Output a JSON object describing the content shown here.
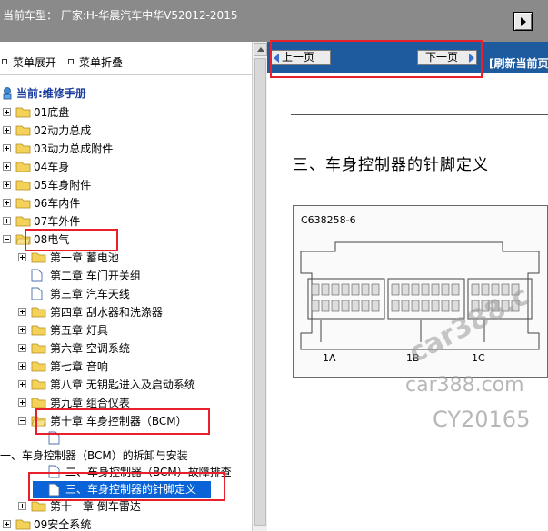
{
  "header": {
    "title": "当前车型： 厂家:H-华晨汽车中华V52012-2015"
  },
  "menu_tools": {
    "expand": "菜单展开",
    "collapse": "菜单折叠"
  },
  "tree": {
    "root": "当前:维修手册",
    "items": [
      {
        "label": "01底盘"
      },
      {
        "label": "02动力总成"
      },
      {
        "label": "03动力总成附件"
      },
      {
        "label": "04车身"
      },
      {
        "label": "05车身附件"
      },
      {
        "label": "06车内件"
      },
      {
        "label": "07车外件"
      },
      {
        "label": "08电气"
      }
    ],
    "chapters": [
      {
        "label": "第一章 蓄电池",
        "type": "folder",
        "expandable": true
      },
      {
        "label": "第二章 车门开关组",
        "type": "doc",
        "expandable": false
      },
      {
        "label": "第三章 汽车天线",
        "type": "doc",
        "expandable": false
      },
      {
        "label": "第四章 刮水器和洗涤器",
        "type": "folder",
        "expandable": true
      },
      {
        "label": "第五章 灯具",
        "type": "folder",
        "expandable": true
      },
      {
        "label": "第六章 空调系统",
        "type": "folder",
        "expandable": true
      },
      {
        "label": "第七章 音响",
        "type": "folder",
        "expandable": true
      },
      {
        "label": "第八章 无钥匙进入及启动系统",
        "type": "folder",
        "expandable": true
      },
      {
        "label": "第九章 组合仪表",
        "type": "folder",
        "expandable": true
      },
      {
        "label": "第十章 车身控制器（BCM）",
        "type": "folder",
        "expandable": true
      }
    ],
    "bcm_section": "一、车身控制器（BCM）的拆卸与安装",
    "bcm_children": [
      "二、车身控制器（BCM）故障排查",
      "三、车身控制器的针脚定义"
    ],
    "chapter11": "第十一章 倒车雷达",
    "system09": "09安全系统"
  },
  "nav": {
    "prev": "上一页",
    "next": "下一页",
    "refresh": "[刷新当前页"
  },
  "document": {
    "title": "三、车身控制器的针脚定义",
    "figure_code": "C638258-6",
    "pin_labels": [
      "1A",
      "1B",
      "1C"
    ]
  },
  "watermark": {
    "line1": "car388.com",
    "line2": "car388.c",
    "line3": "CY20165"
  },
  "colors": {
    "header_bg": "#8a8a8a",
    "nav_bg": "#1e5b9e",
    "highlight_red": "#e8202a",
    "selected_bg": "#0a64d8",
    "folder_yellow": "#f4d25a"
  }
}
